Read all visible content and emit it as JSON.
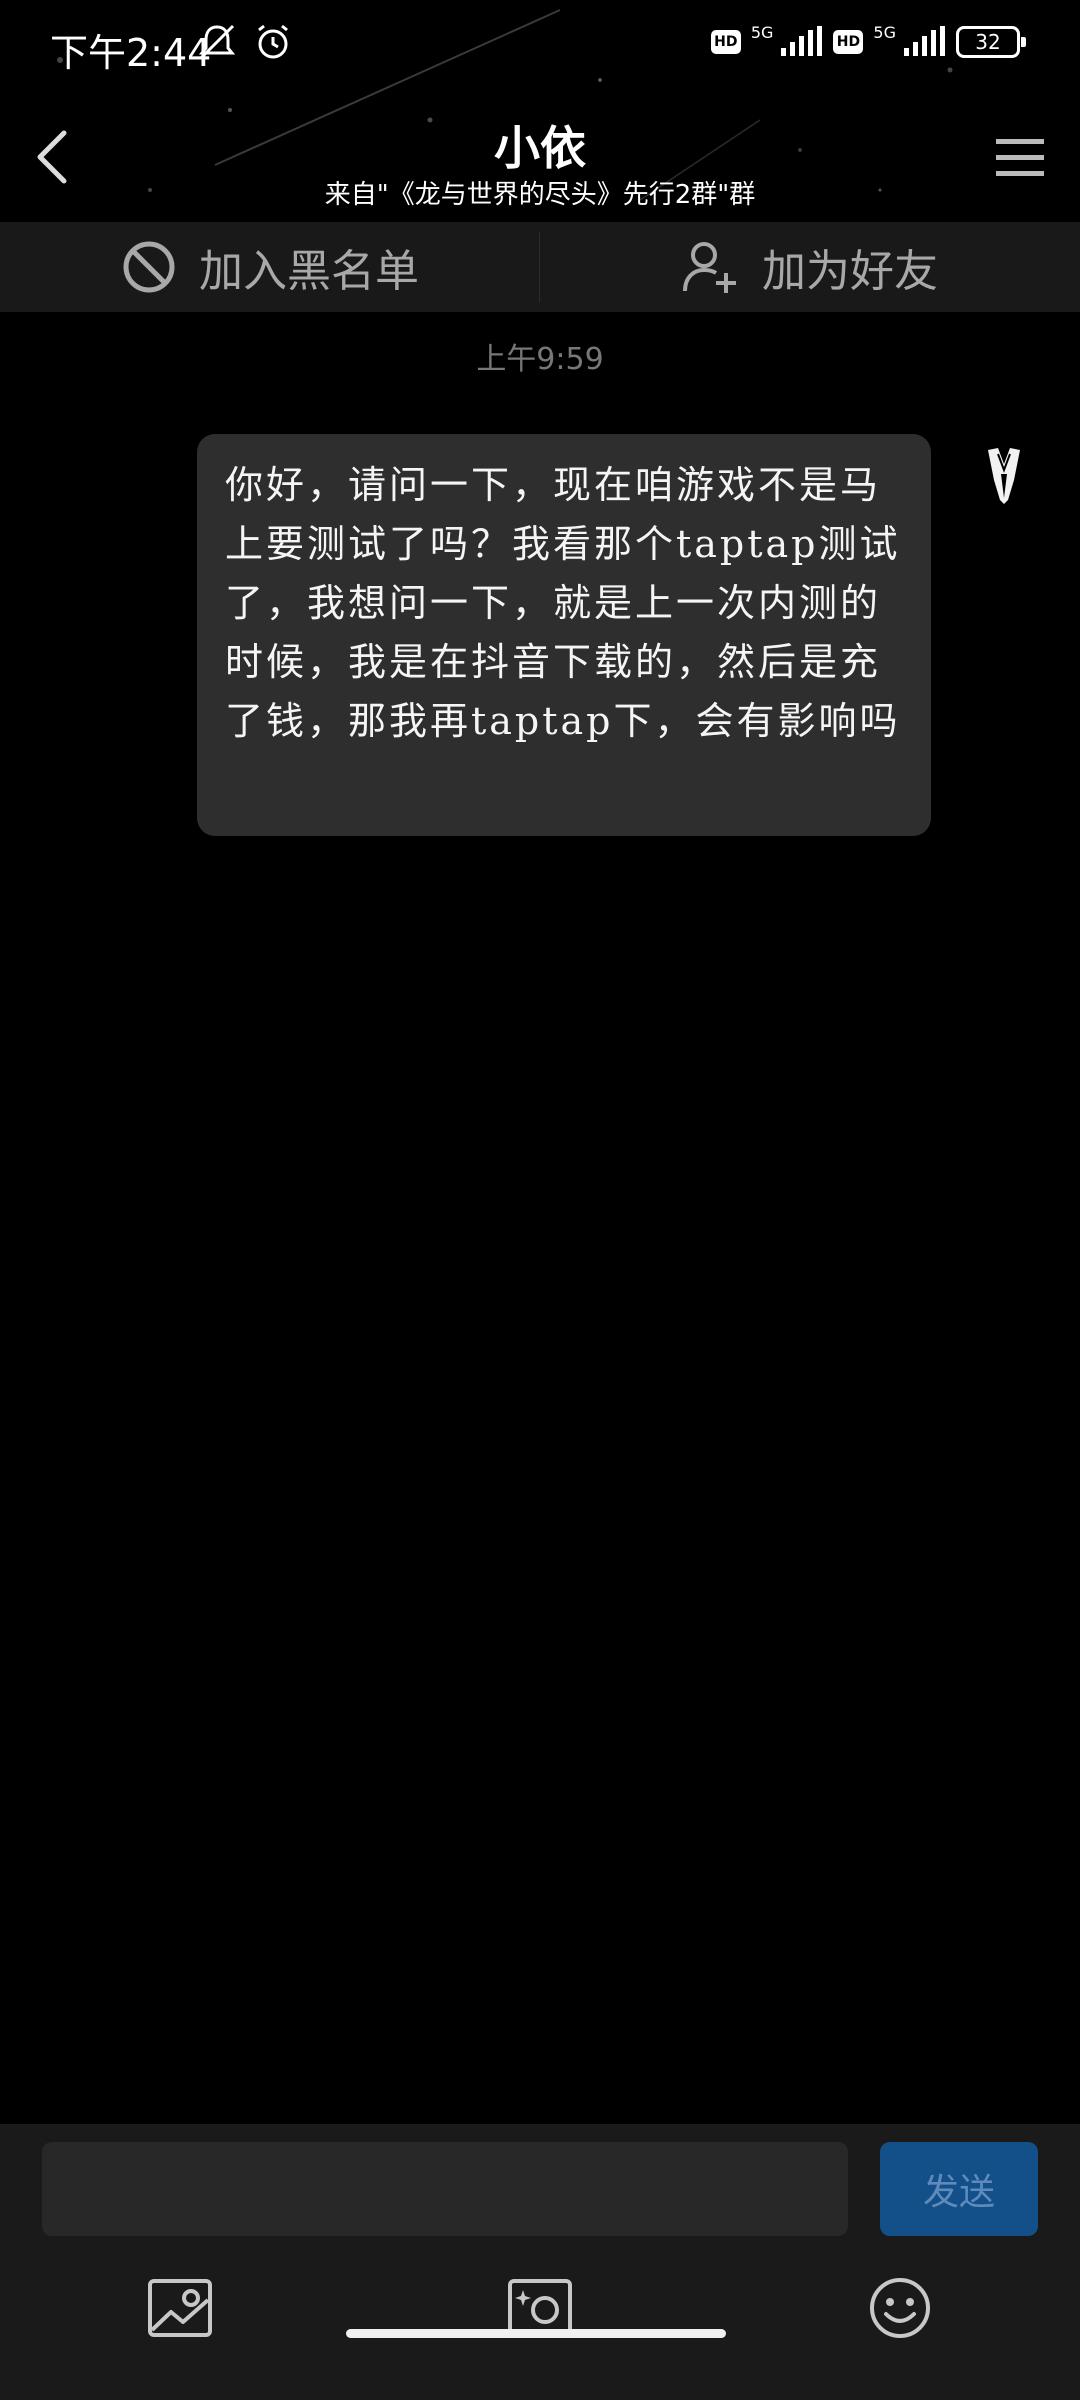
{
  "status_bar": {
    "time": "下午2:44",
    "network_1": "5G",
    "network_2": "5G",
    "hd_1": "HD",
    "hd_2": "HD",
    "battery": "32"
  },
  "header": {
    "title": "小依",
    "subtitle": "来自\"《龙与世界的尽头》先行2群\"群"
  },
  "actions": {
    "blacklist_label": "加入黑名单",
    "add_friend_label": "加为好友"
  },
  "chat": {
    "timestamp": "上午9:59",
    "message": "你好，请问一下，现在咱游戏不是马上要测试了吗？我看那个taptap测试了，我想问一下，就是上一次内测的时候，我是在抖音下载的，然后是充了钱，那我再taptap下，会有影响吗"
  },
  "composer": {
    "send_label": "发送"
  },
  "icons": {
    "back": "chevron-left-icon",
    "menu": "menu-icon",
    "block": "block-icon",
    "add_user": "add-user-icon",
    "image": "image-icon",
    "camera": "camera-icon",
    "emoji": "emoji-icon"
  },
  "colors": {
    "background": "#000000",
    "bubble": "#2e2e2e",
    "send_button": "#13508a",
    "action_bar": "#191919"
  }
}
